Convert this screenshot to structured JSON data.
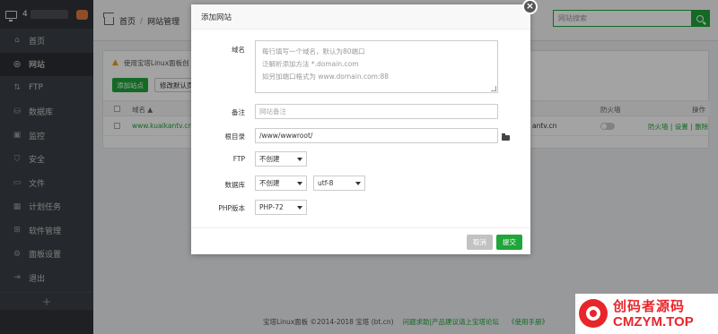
{
  "sidebar": {
    "server_label": "4",
    "items": [
      {
        "icon": "home-icon",
        "glyph": "⌂",
        "label": "首页"
      },
      {
        "icon": "globe-icon",
        "glyph": "◎",
        "label": "网站"
      },
      {
        "icon": "ftp-icon",
        "glyph": "⇅",
        "label": "FTP"
      },
      {
        "icon": "database-icon",
        "glyph": "⛁",
        "label": "数据库"
      },
      {
        "icon": "monitor-icon",
        "glyph": "▣",
        "label": "监控"
      },
      {
        "icon": "shield-icon",
        "glyph": "⛉",
        "label": "安全"
      },
      {
        "icon": "folder-icon",
        "glyph": "▭",
        "label": "文件"
      },
      {
        "icon": "calendar-icon",
        "glyph": "▦",
        "label": "计划任务"
      },
      {
        "icon": "apps-icon",
        "glyph": "⊞",
        "label": "软件管理"
      },
      {
        "icon": "settings-icon",
        "glyph": "⚙",
        "label": "面板设置"
      },
      {
        "icon": "logout-icon",
        "glyph": "⇥",
        "label": "退出"
      }
    ],
    "add_glyph": "+"
  },
  "header": {
    "crumb_home": "首页",
    "crumb_sep": "/",
    "crumb_current": "网站管理",
    "search_placeholder": "网站搜索"
  },
  "main": {
    "alert": "使用宝塔Linux面板创",
    "add_site_button": "添加站点",
    "default_page_button": "修改默认页",
    "columns": {
      "name": "域名 ▲",
      "firewall": "防火墙",
      "actions": "操作"
    },
    "rows": [
      {
        "name": "www.kuaikantv.cn",
        "remark": "antv.cn",
        "actions": "防火墙 | 设置 | 删除"
      }
    ]
  },
  "footer": {
    "copyright": "宝塔Linux面板 ©2014-2018 宝塔 (bt.cn)",
    "forum_link": "问题求助|产品建议请上宝塔论坛",
    "manual_link": "《使用手册》"
  },
  "modal": {
    "title": "添加网站",
    "close_glyph": "×",
    "domain_label": "域名",
    "domain_hint_1": "每行填写一个域名，默认为80端口",
    "domain_hint_2": "泛解析添加方法 *.domain.com",
    "domain_hint_3": "如另加端口格式为 www.domain.com:88",
    "remark_label": "备注",
    "remark_placeholder": "网站备注",
    "root_label": "根目录",
    "root_value": "/www/wwwroot/",
    "ftp_label": "FTP",
    "ftp_value": "不创建",
    "db_label": "数据库",
    "db_value": "不创建",
    "charset_value": "utf-8",
    "php_label": "PHP版本",
    "php_value": "PHP-72",
    "cancel_button": "取消",
    "submit_button": "提交"
  },
  "watermark": {
    "line1": "创码者源码",
    "line2": "CMZYM.TOP"
  },
  "colors": {
    "accent": "#20a53a",
    "sidebar": "#3b3f45",
    "watermark": "#e8252b"
  }
}
